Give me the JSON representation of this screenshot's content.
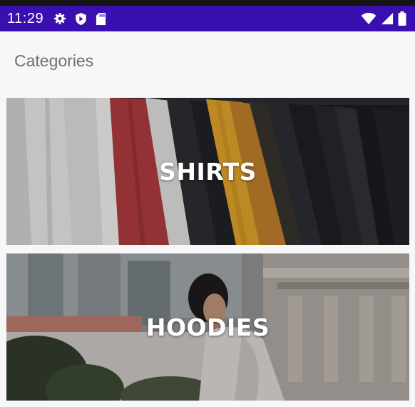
{
  "status_bar": {
    "time": "11:29",
    "left_icons": [
      "gear-icon",
      "shield-icon",
      "sd-card-icon"
    ],
    "right_icons": [
      "wifi-icon",
      "signal-icon",
      "battery-icon"
    ],
    "background_color": "#3a0fb0"
  },
  "screen": {
    "title": "Categories"
  },
  "categories": [
    {
      "label": "SHIRTS",
      "image": "shirts-photo"
    },
    {
      "label": "HOODIES",
      "image": "hoodie-photo"
    }
  ]
}
